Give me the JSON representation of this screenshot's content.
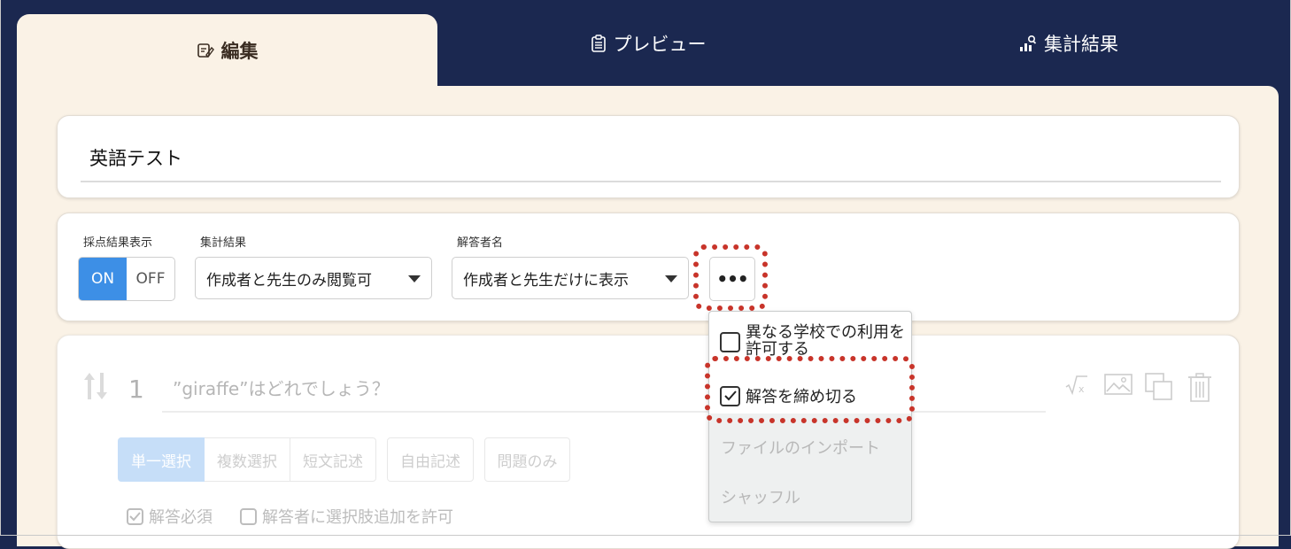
{
  "tabs": {
    "edit": "編集",
    "preview": "プレビュー",
    "results": "集計結果"
  },
  "form_title": "英語テスト",
  "settings": {
    "score_label": "採点結果表示",
    "toggle_on": "ON",
    "toggle_off": "OFF",
    "toggle_selected": "ON",
    "summary_label": "集計結果",
    "summary_value": "作成者と先生のみ閲覧可",
    "respondent_label": "解答者名",
    "respondent_value": "作成者と先生だけに表示",
    "more_label": "•••"
  },
  "menu": {
    "allow_other_school": "異なる学校での利用を許可する",
    "allow_other_school_checked": false,
    "close_answers": "解答を締め切る",
    "close_answers_checked": true,
    "import_file": "ファイルのインポート",
    "shuffle": "シャッフル"
  },
  "question": {
    "number": "1",
    "text": "”giraffe”はどれでしょう？",
    "types": [
      "単一選択",
      "複数選択",
      "短文記述",
      "自由記述",
      "問題のみ"
    ],
    "selected_type": "単一選択",
    "required_label": "解答必須",
    "required_checked": true,
    "allow_add_label": "解答者に選択肢追加を許可",
    "allow_add_checked": false
  },
  "colors": {
    "background": "#1b2850",
    "panel": "#faf2e6",
    "accent": "#3d8fe6",
    "highlight": "#c8342a"
  }
}
